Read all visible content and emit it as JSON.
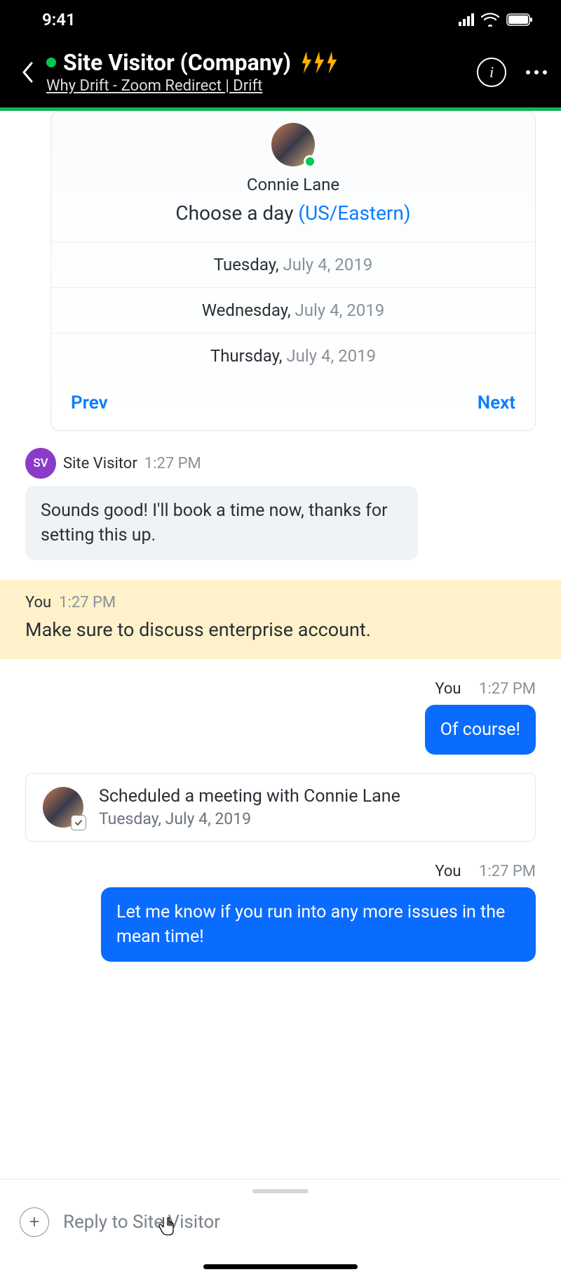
{
  "status": {
    "time": "9:41"
  },
  "header": {
    "title": "Site Visitor (Company)",
    "subtitle": "Why Drift - Zoom Redirect | Drift",
    "info_label": "i"
  },
  "scheduler": {
    "name": "Connie Lane",
    "choose_label": "Choose a day ",
    "timezone": "(US/Eastern)",
    "days": [
      {
        "weekday": "Tuesday, ",
        "date": "July 4, 2019"
      },
      {
        "weekday": "Wednesday, ",
        "date": "July 4, 2019"
      },
      {
        "weekday": "Thursday, ",
        "date": "July 4, 2019"
      }
    ],
    "prev": "Prev",
    "next": "Next"
  },
  "messages": {
    "visitor": {
      "avatar_initials": "SV",
      "name": "Site Visitor",
      "time": "1:27 PM",
      "text": "Sounds good! I'll book a time now, thanks for setting this up."
    },
    "note": {
      "name": "You",
      "time": "1:27 PM",
      "text": "Make sure to discuss enterprise account."
    },
    "reply1": {
      "name": "You",
      "time": "1:27 PM",
      "text": "Of course!"
    },
    "event": {
      "title": "Scheduled a meeting with Connie Lane",
      "date": "Tuesday, July 4, 2019"
    },
    "reply2": {
      "name": "You",
      "time": "1:27 PM",
      "text": "Let me know if you run into any more issues in the mean time!"
    }
  },
  "composer": {
    "placeholder": "Reply to Site Visitor"
  }
}
